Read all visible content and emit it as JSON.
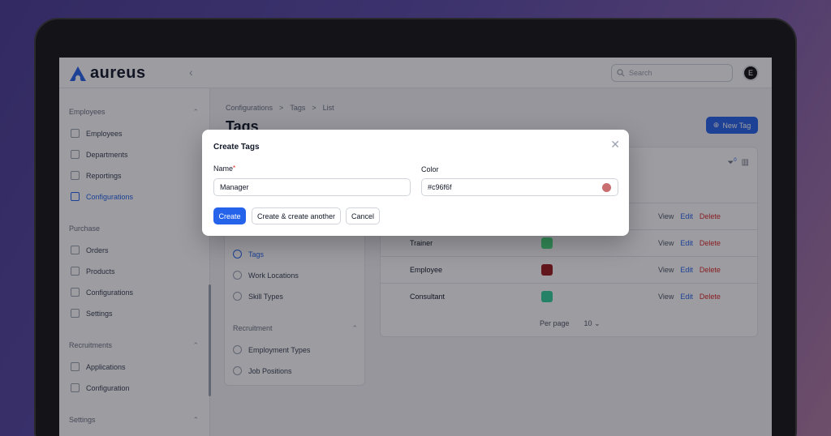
{
  "app": {
    "name": "aureus",
    "user_initial": "E"
  },
  "topbar": {
    "search_placeholder": "Search",
    "collapse_icon": "chevron-left-icon"
  },
  "sidebar": {
    "groups": [
      {
        "label": "Employees",
        "items": [
          "Employees",
          "Departments",
          "Reportings",
          "Configurations"
        ]
      },
      {
        "label": "Purchase",
        "items": [
          "Orders",
          "Products",
          "Configurations",
          "Settings"
        ]
      },
      {
        "label": "Recruitments",
        "items": [
          "Applications",
          "Configuration"
        ]
      },
      {
        "label": "Settings",
        "items": []
      }
    ],
    "active_item": "Configurations"
  },
  "breadcrumb": [
    "Configurations",
    ">",
    "Tags",
    ">",
    "List"
  ],
  "page": {
    "title": "Tags",
    "new_button": "New Tag"
  },
  "config_panel": {
    "items": [
      "Tags",
      "Work Locations",
      "Skill Types"
    ],
    "active": "Tags",
    "group": "Recruitment",
    "group_items": [
      "Employment Types",
      "Job Positions"
    ]
  },
  "table": {
    "filter_badge": "0",
    "rows": [
      {
        "name": "",
        "color": "#c96f6f"
      },
      {
        "name": "Trainer",
        "color": "#4ade80"
      },
      {
        "name": "Employee",
        "color": "#991b1b"
      },
      {
        "name": "Consultant",
        "color": "#34d399"
      }
    ],
    "actions": {
      "view": "View",
      "edit": "Edit",
      "delete": "Delete"
    },
    "per_page_label": "Per page",
    "per_page_value": "10"
  },
  "modal": {
    "title": "Create Tags",
    "name_label": "Name",
    "required_mark": "*",
    "name_value": "Manager",
    "color_label": "Color",
    "color_value": "#c96f6f",
    "create": "Create",
    "create_another": "Create & create another",
    "cancel": "Cancel"
  },
  "colors": {
    "accent": "#2563eb",
    "danger": "#dc2626",
    "swatch": "#c96f6f"
  }
}
